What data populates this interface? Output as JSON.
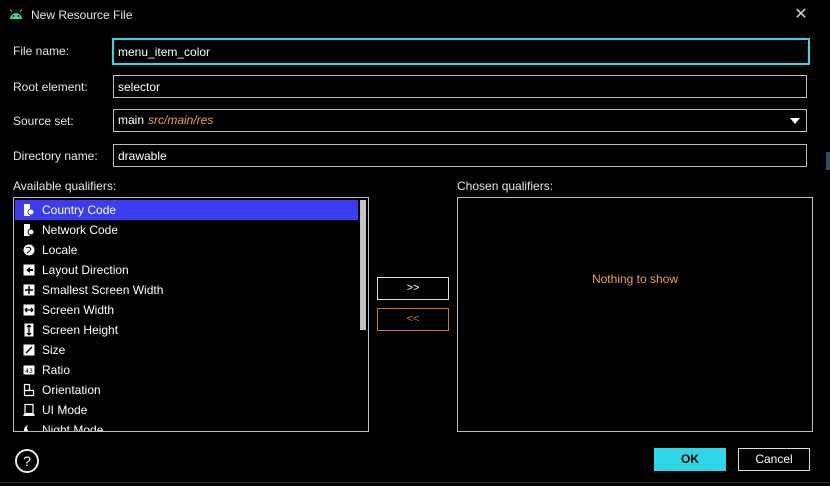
{
  "window": {
    "title": "New Resource File",
    "close_icon": "close-icon"
  },
  "form": {
    "file_name_label": "File name:",
    "file_name_value": "menu_item_color",
    "root_element_label": "Root element:",
    "root_element_value": "selector",
    "source_set_label": "Source set:",
    "source_set_value": "main",
    "source_set_path": "src/main/res",
    "directory_name_label": "Directory name:",
    "directory_name_value": "drawable"
  },
  "qualifiers": {
    "available_label": "Available qualifiers:",
    "chosen_label": "Chosen qualifiers:",
    "items": [
      {
        "label": "Country Code",
        "icon": "country-code-icon",
        "selected": true
      },
      {
        "label": "Network Code",
        "icon": "network-code-icon"
      },
      {
        "label": "Locale",
        "icon": "globe-icon"
      },
      {
        "label": "Layout Direction",
        "icon": "layout-direction-icon"
      },
      {
        "label": "Smallest Screen Width",
        "icon": "smallest-width-icon"
      },
      {
        "label": "Screen Width",
        "icon": "screen-width-icon"
      },
      {
        "label": "Screen Height",
        "icon": "screen-height-icon"
      },
      {
        "label": "Size",
        "icon": "size-icon"
      },
      {
        "label": "Ratio",
        "icon": "ratio-icon"
      },
      {
        "label": "Orientation",
        "icon": "orientation-icon"
      },
      {
        "label": "UI Mode",
        "icon": "ui-mode-icon"
      },
      {
        "label": "Night Mode",
        "icon": "night-mode-icon"
      }
    ],
    "add_label": ">>",
    "remove_label": "<<",
    "empty_text": "Nothing to show"
  },
  "footer": {
    "help_label": "?",
    "ok_label": "OK",
    "cancel_label": "Cancel"
  },
  "colors": {
    "accent": "#2fd6e8",
    "selection": "#3b3cf0",
    "warning": "#e8a35a"
  }
}
